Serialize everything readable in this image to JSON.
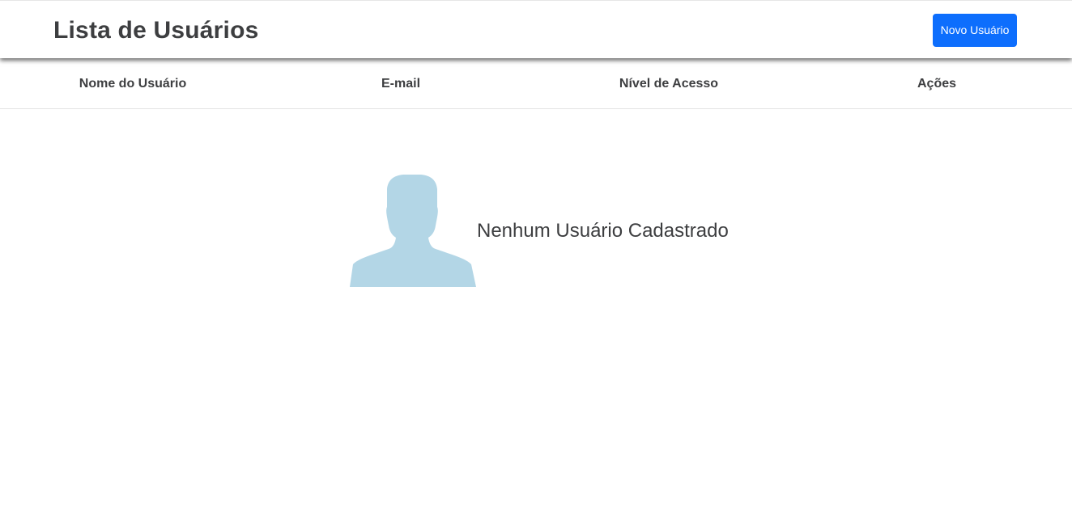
{
  "header": {
    "title": "Lista de Usuários",
    "new_user_label": "Novo Usuário"
  },
  "table": {
    "columns": [
      "Nome do Usuário",
      "E-mail",
      "Nível de Acesso",
      "Ações"
    ]
  },
  "empty_state": {
    "message": "Nenhum Usuário Cadastrado",
    "icon": "user-silhouette-icon"
  },
  "colors": {
    "primary_button": "#0d6efd",
    "avatar": "#b3d6e6",
    "text": "#3d3e40"
  }
}
